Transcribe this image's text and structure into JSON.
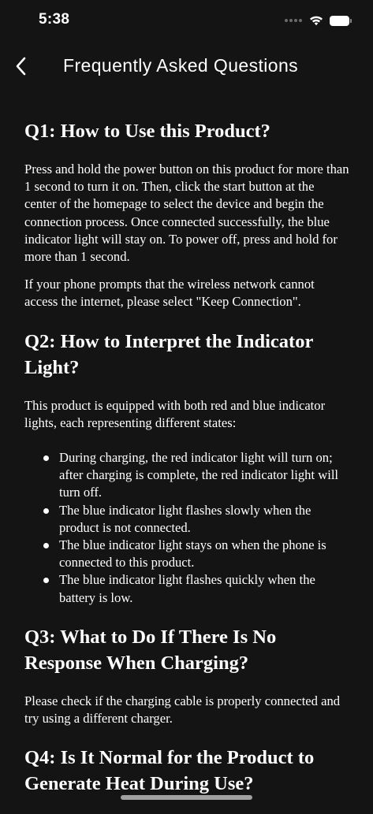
{
  "status_bar": {
    "time": "5:38",
    "icons": [
      "signal-icon",
      "wifi-icon",
      "battery-icon"
    ]
  },
  "nav": {
    "back_icon": "chevron-left-icon",
    "title": "Frequently Asked Questions"
  },
  "faq": {
    "q1": {
      "question": "Q1: How to Use this Product?",
      "paragraphs": [
        "Press and hold the power button on this product for more than 1 second to turn it on. Then, click the start button at the center of the homepage to select the device and begin the connection process. Once connected successfully, the blue indicator light will stay on. To power off, press and hold for more than 1 second.",
        "If your phone prompts that the wireless network cannot access the internet, please select \"Keep Connection\"."
      ]
    },
    "q2": {
      "question": "Q2: How to Interpret the Indicator Light?",
      "intro": "This product is equipped with both red and blue indicator lights, each representing different states:",
      "items": [
        "During charging, the red indicator light will turn on; after charging is complete, the red indicator light will turn off.",
        "The blue indicator light flashes slowly when the product is not connected.",
        "The blue indicator light stays on when the phone is connected to this product.",
        "The blue indicator light flashes quickly when the battery is low."
      ]
    },
    "q3": {
      "question": "Q3: What to Do If There Is No Response When Charging?",
      "paragraphs": [
        "Please check if the charging cable is properly connected and try using a different charger."
      ]
    },
    "q4": {
      "question": "Q4: Is It Normal for the Product to Generate Heat During Use?"
    }
  },
  "colors": {
    "background": "#141414",
    "text": "#ffffff",
    "home_indicator": "#a0a0a0"
  }
}
